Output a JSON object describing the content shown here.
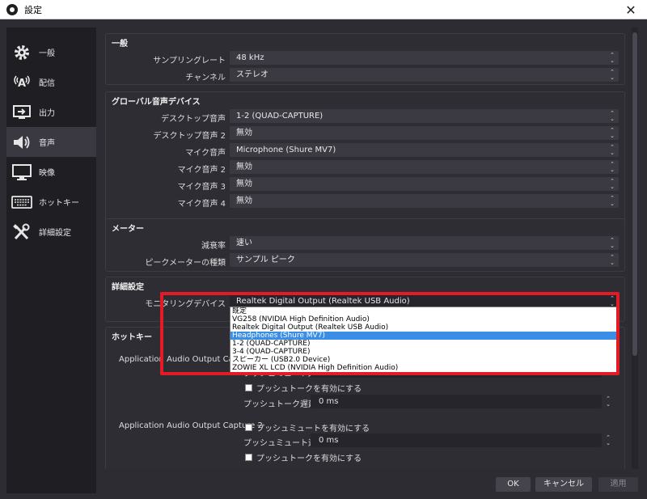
{
  "window": {
    "title": "設定",
    "close_glyph": "✕"
  },
  "sidebar": {
    "items": [
      {
        "label": "一般",
        "icon": "gear-icon"
      },
      {
        "label": "配信",
        "icon": "broadcast-icon"
      },
      {
        "label": "出力",
        "icon": "output-icon"
      },
      {
        "label": "音声",
        "icon": "speaker-icon",
        "active": true
      },
      {
        "label": "映像",
        "icon": "monitor-icon"
      },
      {
        "label": "ホットキー",
        "icon": "keyboard-icon"
      },
      {
        "label": "詳細設定",
        "icon": "tools-icon"
      }
    ]
  },
  "general": {
    "title": "一般",
    "sample_rate_label": "サンプリングレート",
    "sample_rate_value": "48 kHz",
    "channel_label": "チャンネル",
    "channel_value": "ステレオ"
  },
  "global_audio": {
    "title": "グローバル音声デバイス",
    "rows": [
      {
        "label": "デスクトップ音声",
        "value": "1-2 (QUAD-CAPTURE)"
      },
      {
        "label": "デスクトップ音声 2",
        "value": "無効"
      },
      {
        "label": "マイク音声",
        "value": "Microphone (Shure MV7)"
      },
      {
        "label": "マイク音声 2",
        "value": "無効"
      },
      {
        "label": "マイク音声 3",
        "value": "無効"
      },
      {
        "label": "マイク音声 4",
        "value": "無効"
      }
    ]
  },
  "meter": {
    "title": "メーター",
    "decay_label": "減衰率",
    "decay_value": "速い",
    "peak_label": "ピークメーターの種類",
    "peak_value": "サンプル ピーク"
  },
  "advanced": {
    "title": "詳細設定",
    "monitor_label": "モニタリングデバイス",
    "monitor_value": "Realtek Digital Output (Realtek USB Audio)",
    "options": [
      "既定",
      "VG258 (NVIDIA High Definition Audio)",
      "Realtek Digital Output (Realtek USB Audio)",
      "Headphones (Shure MV7)",
      "1-2 (QUAD-CAPTURE)",
      "3-4 (QUAD-CAPTURE)",
      "スピーカー (USB2.0 Device)",
      "ZOWIE XL LCD (NVIDIA High Definition Audio)"
    ],
    "selected_index": 3
  },
  "hotkeys": {
    "title": "ホットキー",
    "capture1_label": "Application Audio Output Capture",
    "mute_delay_label": "プッシュミュート遅延",
    "mute_delay_value": "0 ms",
    "ptt_enable_label": "プッシュトークを有効にする",
    "ptt_delay_label": "プッシュトーク遅延",
    "ptt_delay_value": "0 ms",
    "capture2_label": "Application Audio Output Capture 2",
    "mute_enable_label": "プッシュミュートを有効にする",
    "mute_delay2_value": "0 ms",
    "ptt_enable2_label": "プッシュトークを有効にする"
  },
  "buttons": {
    "ok": "OK",
    "cancel": "キャンセル",
    "apply": "適用"
  },
  "colors": {
    "highlight": "#e41b25",
    "selected_option": "#3a8ee6"
  }
}
